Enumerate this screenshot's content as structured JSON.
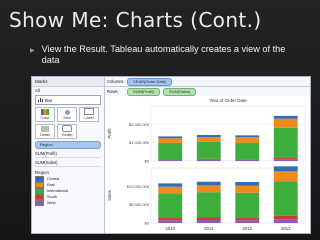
{
  "slide": {
    "title": "Show Me: Charts (Cont.)",
    "bullet": "View the Result. Tableau automatically creates a view of the data"
  },
  "marks_card": {
    "header": "Marks",
    "all_label": "All",
    "mark_type": "Bar",
    "tiles": [
      "Color",
      "Size",
      "Label",
      "Detail",
      "Tooltip"
    ],
    "color_pill": "Region",
    "measures": [
      "SUM(Profit)",
      "SUM(Sales)"
    ],
    "legend_title": "Region",
    "legend": [
      {
        "label": "Central",
        "color": "#2f6db5"
      },
      {
        "label": "East",
        "color": "#f08a1c"
      },
      {
        "label": "International",
        "color": "#3cae3c"
      },
      {
        "label": "South",
        "color": "#d23a2f"
      },
      {
        "label": "West",
        "color": "#8a5cb7"
      }
    ]
  },
  "shelves": {
    "columns_label": "Columns",
    "columns_pill": "YEAR(Order Date)",
    "rows_label": "Rows",
    "rows_pills": [
      "SUM(Profit)",
      "SUM(Sales)"
    ]
  },
  "chart_data": {
    "type": "bar",
    "title": "Year of Order Date",
    "categories": [
      "2010",
      "2011",
      "2012",
      "2013"
    ],
    "panels": [
      {
        "ylabel": "Profit",
        "ylim": [
          0,
          3000000
        ],
        "ticks": [
          "$0",
          "$1,000,000",
          "$2,000,000"
        ],
        "series": [
          {
            "name": "West",
            "values": [
              50000,
              70000,
              60000,
              90000
            ]
          },
          {
            "name": "South",
            "values": [
              40000,
              50000,
              40000,
              70000
            ]
          },
          {
            "name": "International",
            "values": [
              900000,
              930000,
              900000,
              1650000
            ]
          },
          {
            "name": "East",
            "values": [
              250000,
              260000,
              300000,
              500000
            ]
          },
          {
            "name": "Central",
            "values": [
              100000,
              110000,
              100000,
              150000
            ]
          }
        ]
      },
      {
        "ylabel": "Sales",
        "ylim": [
          0,
          10000000
        ],
        "ticks": [
          "$0",
          "$5,000,000",
          "$10,000,000"
        ],
        "series": [
          {
            "name": "West",
            "values": [
              500000,
              550000,
              500000,
              700000
            ]
          },
          {
            "name": "South",
            "values": [
              400000,
              450000,
              400000,
              600000
            ]
          },
          {
            "name": "International",
            "values": [
              4500000,
              4600000,
              4600000,
              6300000
            ]
          },
          {
            "name": "East",
            "values": [
              1200000,
              1250000,
              1300000,
              1800000
            ]
          },
          {
            "name": "Central",
            "values": [
              600000,
              650000,
              650000,
              900000
            ]
          }
        ]
      }
    ]
  }
}
